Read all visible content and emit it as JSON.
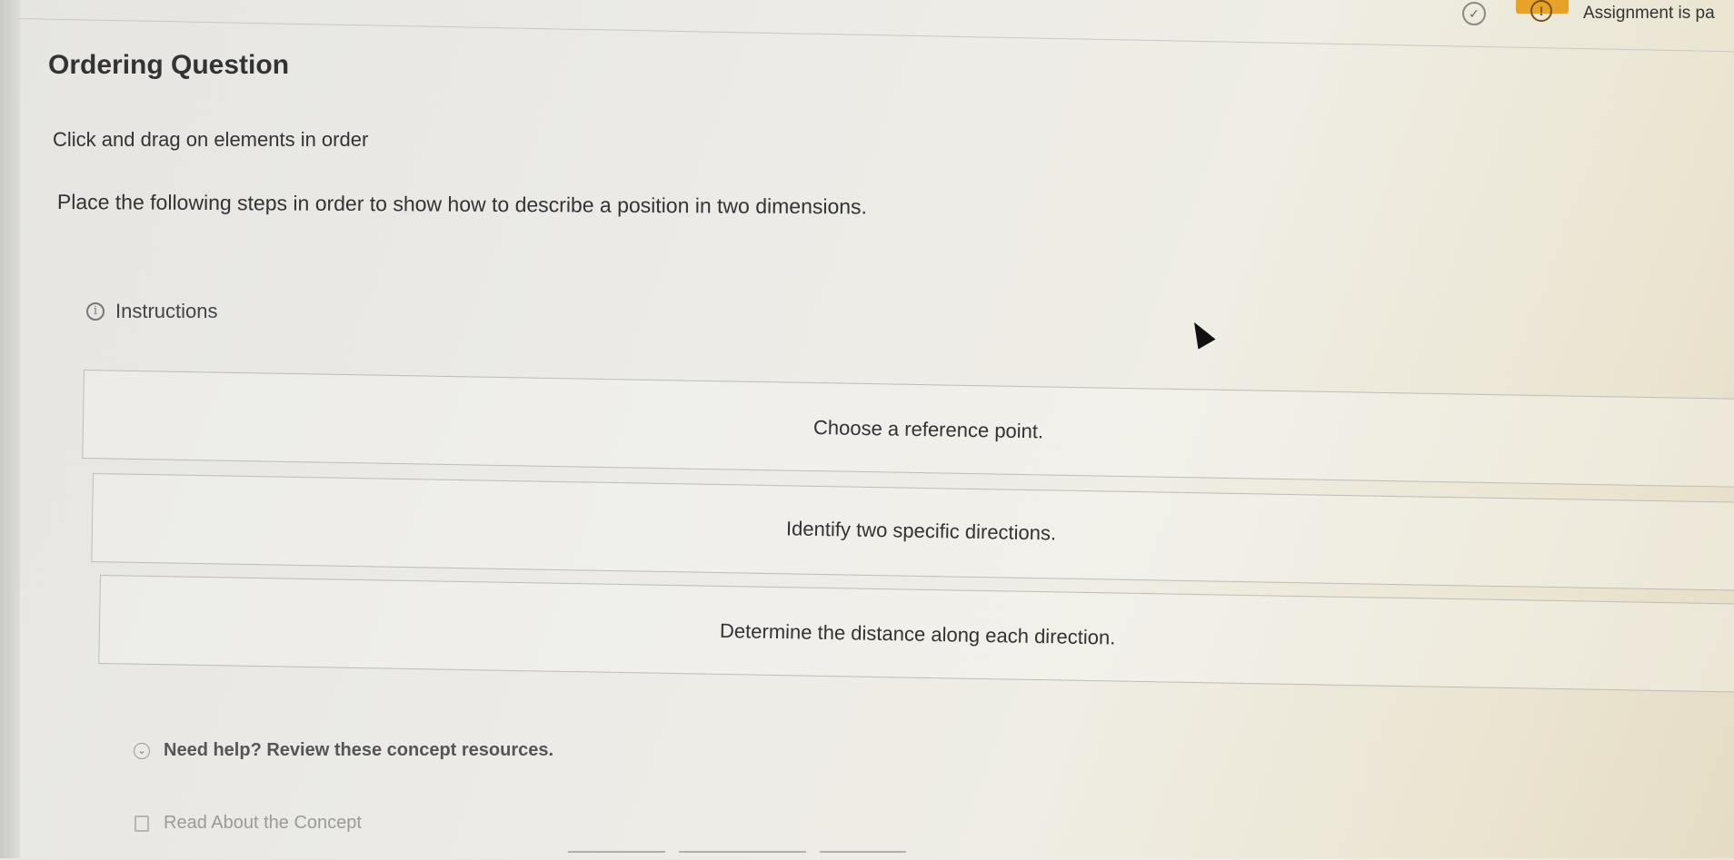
{
  "header": {
    "check_glyph": "✓",
    "alert_glyph": "!",
    "assignment_text": "Assignment is pa"
  },
  "question": {
    "title": "Ordering Question",
    "instruction": "Click and drag on elements in order",
    "prompt": "Place the following steps in order to show how to describe a position in two dimensions.",
    "instructions_label": "Instructions",
    "info_glyph": "i"
  },
  "items": [
    {
      "label": "Choose a reference point."
    },
    {
      "label": "Identify two specific directions."
    },
    {
      "label": "Determine the distance along each direction."
    }
  ],
  "help": {
    "label": "Need help? Review these concept resources.",
    "chevron_glyph": "⌄",
    "read_label": "Read About the Concept"
  },
  "colors": {
    "alert": "#e9a229",
    "text": "#333333"
  }
}
